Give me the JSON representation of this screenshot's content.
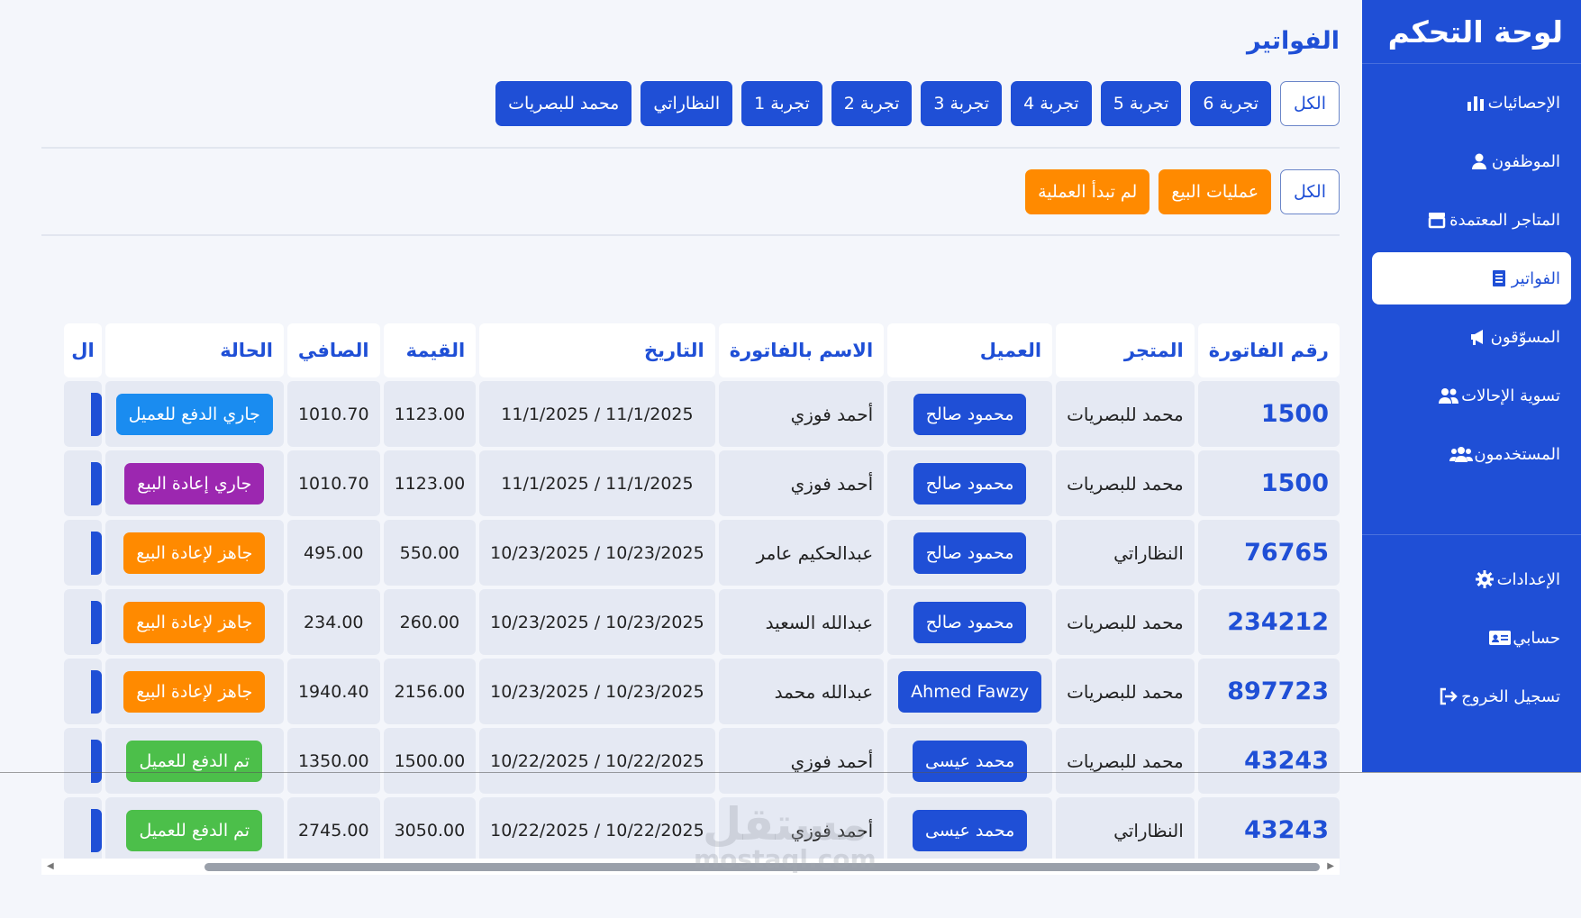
{
  "sidebar": {
    "title": "لوحة التحكم",
    "items": [
      {
        "label": "الإحصائيات",
        "icon": "bar-chart-icon"
      },
      {
        "label": "الموظفون",
        "icon": "user-icon"
      },
      {
        "label": "المتاجر المعتمدة",
        "icon": "store-icon"
      },
      {
        "label": "الفواتير",
        "icon": "receipt-icon",
        "active": true
      },
      {
        "label": "المسوّقون",
        "icon": "megaphone-icon"
      },
      {
        "label": "تسوية الإحالات",
        "icon": "users-icon"
      },
      {
        "label": "المستخدمون",
        "icon": "users-group-icon"
      }
    ],
    "bottom_items": [
      {
        "label": "الإعدادات",
        "icon": "gear-icon"
      },
      {
        "label": "حسابي",
        "icon": "id-card-icon"
      },
      {
        "label": "تسجيل الخروج",
        "icon": "logout-icon"
      }
    ]
  },
  "main": {
    "title": "الفواتير",
    "store_filters": [
      "الكل",
      "تجربة 6",
      "تجربة 5",
      "تجربة 4",
      "تجربة 3",
      "تجربة 2",
      "تجربة 1",
      "النظاراتي",
      "محمد للبصريات"
    ],
    "type_filters": [
      "الكل",
      "عمليات البيع",
      "لم تبدأ العملية"
    ]
  },
  "table": {
    "headers": [
      "رقم الفاتورة",
      "المتجر",
      "العميل",
      "الاسم بالفاتورة",
      "التاريخ",
      "القيمة",
      "الصافي",
      "الحالة",
      "ال"
    ],
    "rows": [
      {
        "number": "1500",
        "store": "محمد للبصريات",
        "client": "محمود صالح",
        "invoice_name": "أحمد فوزي",
        "date": "11/1/2025 / 11/1/2025",
        "amount": "1123.00",
        "net": "1010.70",
        "status": "جاري الدفع للعميل"
      },
      {
        "number": "1500",
        "store": "محمد للبصريات",
        "client": "محمود صالح",
        "invoice_name": "أحمد فوزي",
        "date": "11/1/2025 / 11/1/2025",
        "amount": "1123.00",
        "net": "1010.70",
        "status": "جاري إعادة البيع"
      },
      {
        "number": "76765",
        "store": "النظاراتي",
        "client": "محمود صالح",
        "invoice_name": "عبدالحكيم عامر",
        "date": "10/23/2025 / 10/23/2025",
        "amount": "550.00",
        "net": "495.00",
        "status": "جاهز لإعادة البيع"
      },
      {
        "number": "234212",
        "store": "محمد للبصريات",
        "client": "محمود صالح",
        "invoice_name": "عبدالله السعيد",
        "date": "10/23/2025 / 10/23/2025",
        "amount": "260.00",
        "net": "234.00",
        "status": "جاهز لإعادة البيع"
      },
      {
        "number": "897723",
        "store": "محمد للبصريات",
        "client": "Ahmed Fawzy",
        "invoice_name": "عبدالله محمد",
        "date": "10/23/2025 / 10/23/2025",
        "amount": "2156.00",
        "net": "1940.40",
        "status": "جاهز لإعادة البيع"
      },
      {
        "number": "43243",
        "store": "محمد للبصريات",
        "client": "محمد عيسى",
        "invoice_name": "أحمد فوزي",
        "date": "10/22/2025 / 10/22/2025",
        "amount": "1500.00",
        "net": "1350.00",
        "status": "تم الدفع للعميل"
      },
      {
        "number": "43243",
        "store": "النظاراتي",
        "client": "محمد عيسى",
        "invoice_name": "أحمد فوزي",
        "date": "10/22/2025 / 10/22/2025",
        "amount": "3050.00",
        "net": "2745.00",
        "status": "تم الدفع للعميل"
      }
    ]
  },
  "status_colors": {
    "جاري الدفع للعميل": "#1a8cf0",
    "جاري إعادة البيع": "#9c27b0",
    "جاهز لإعادة البيع": "#ff8a00",
    "تم الدفع للعميل": "#4cbf4a"
  },
  "colors": {
    "primary": "#1f4fd6",
    "orange": "#ff8a00"
  },
  "watermark": {
    "logo_text": "مستقل",
    "domain": "mostaql.com"
  }
}
